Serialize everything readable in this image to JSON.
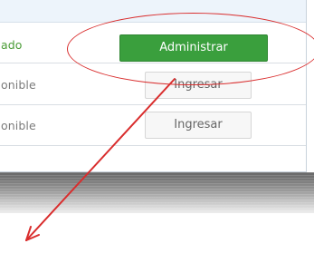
{
  "rows": [
    {
      "status": "ado",
      "button": "Administrar"
    },
    {
      "status": "onible",
      "button": "Ingresar"
    },
    {
      "status": "onible",
      "button": "Ingresar"
    }
  ],
  "colors": {
    "admin_button": "#3a9f3d",
    "secondary_button": "#f7f7f7",
    "highlight_annotation": "#d92d2d",
    "status_active": "#4a9c36",
    "status_available": "#7b7b7b"
  }
}
